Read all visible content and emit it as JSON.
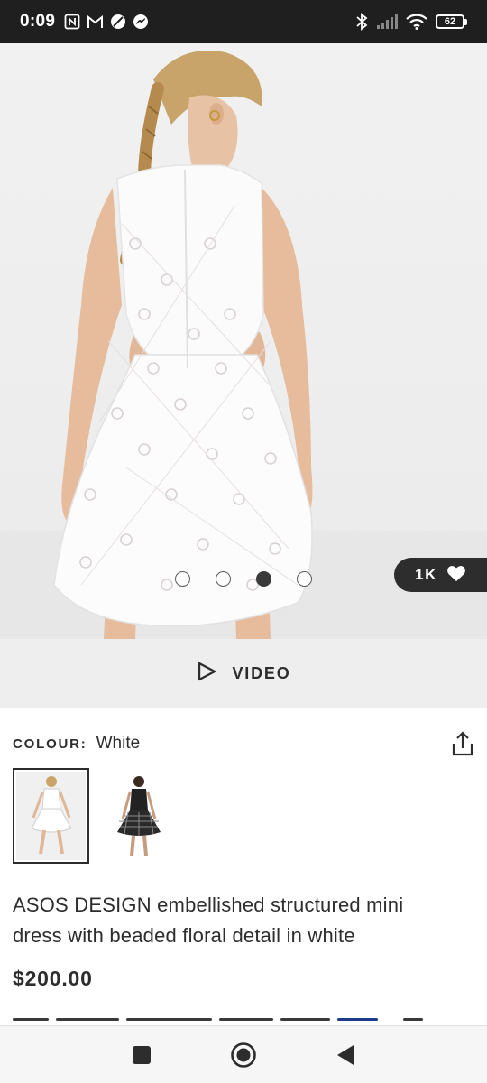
{
  "status_bar": {
    "time": "0:09",
    "left_icons": [
      "nfc-icon",
      "gmail-icon",
      "vpn-icon",
      "messenger-icon"
    ],
    "right_icons": [
      "bluetooth-icon",
      "signal-icon",
      "wifi-icon"
    ],
    "battery": "62"
  },
  "product_image": {
    "alt": "White sleeveless mini dress with beaded floral detail, back view",
    "dots_total": 4,
    "active_dot": 3,
    "saves": "1K"
  },
  "video": {
    "label": "VIDEO"
  },
  "colour": {
    "label": "COLOUR:",
    "value": "White"
  },
  "swatches": [
    {
      "name": "White",
      "selected": true
    },
    {
      "name": "Black check",
      "selected": false
    }
  ],
  "product": {
    "title": "ASOS DESIGN embellished structured mini dress with beaded floral detail in white",
    "price": "$200.00"
  },
  "colors": {
    "status_bar_bg": "#1f1f1f",
    "text_primary": "#2d2d2d",
    "video_bar_bg": "#eeeeee",
    "badge_bg": "#2d2d2d",
    "nav_bg": "#f6f6f6"
  }
}
